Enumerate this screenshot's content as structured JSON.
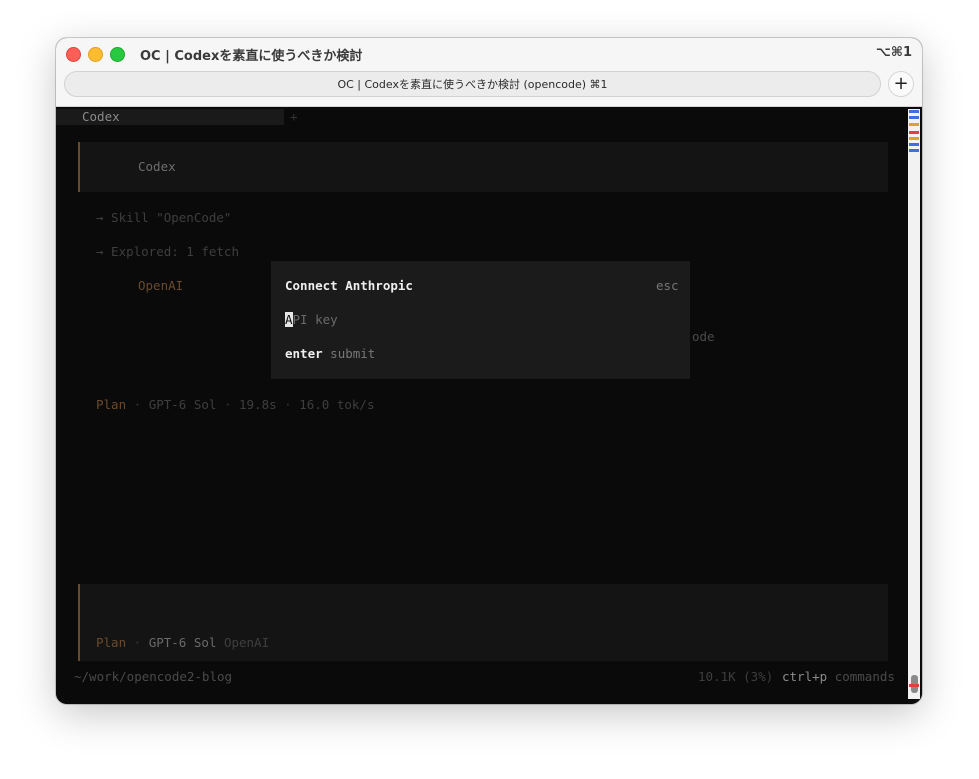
{
  "window": {
    "title": "OC | Codexを素直に使うべきか検討",
    "shortcut": "⌥⌘1",
    "tab_title": "OC | Codexを素直に使うべきか検討 (opencode) ⌘1",
    "new_tab": "+"
  },
  "terminal": {
    "session_tab": "Codex",
    "add_tab": "+",
    "message": "Codex",
    "skill_line": "→ Skill \"OpenCode\"",
    "explored_line": "→ Explored: 1 fetch",
    "openai": "OpenAI",
    "partial_right": "ode",
    "status": {
      "mode": "Plan",
      "sep1": " · ",
      "model": "GPT-6 Sol",
      "sep2": " · ",
      "time": "19.8s",
      "sep3": " · ",
      "rate": "16.0 tok/s"
    },
    "input": {
      "mode": "Plan",
      "sep": " · ",
      "model": "GPT-6 Sol",
      "provider": "OpenAI"
    },
    "footer": {
      "cwd": "~/work/opencode2-blog",
      "tokens": "10.1K (3%)",
      "keys": "ctrl+p",
      "keys_label": "commands"
    }
  },
  "dialog": {
    "title": "Connect Anthropic",
    "close_hint": "esc",
    "input_cursor": "A",
    "input_placeholder": "PI key",
    "submit_key": "enter",
    "submit_label": "submit"
  },
  "colors": {
    "accent": "#6b4a2c",
    "terminal_bg": "#0a0a0a",
    "dialog_bg": "#1b1b1b"
  }
}
